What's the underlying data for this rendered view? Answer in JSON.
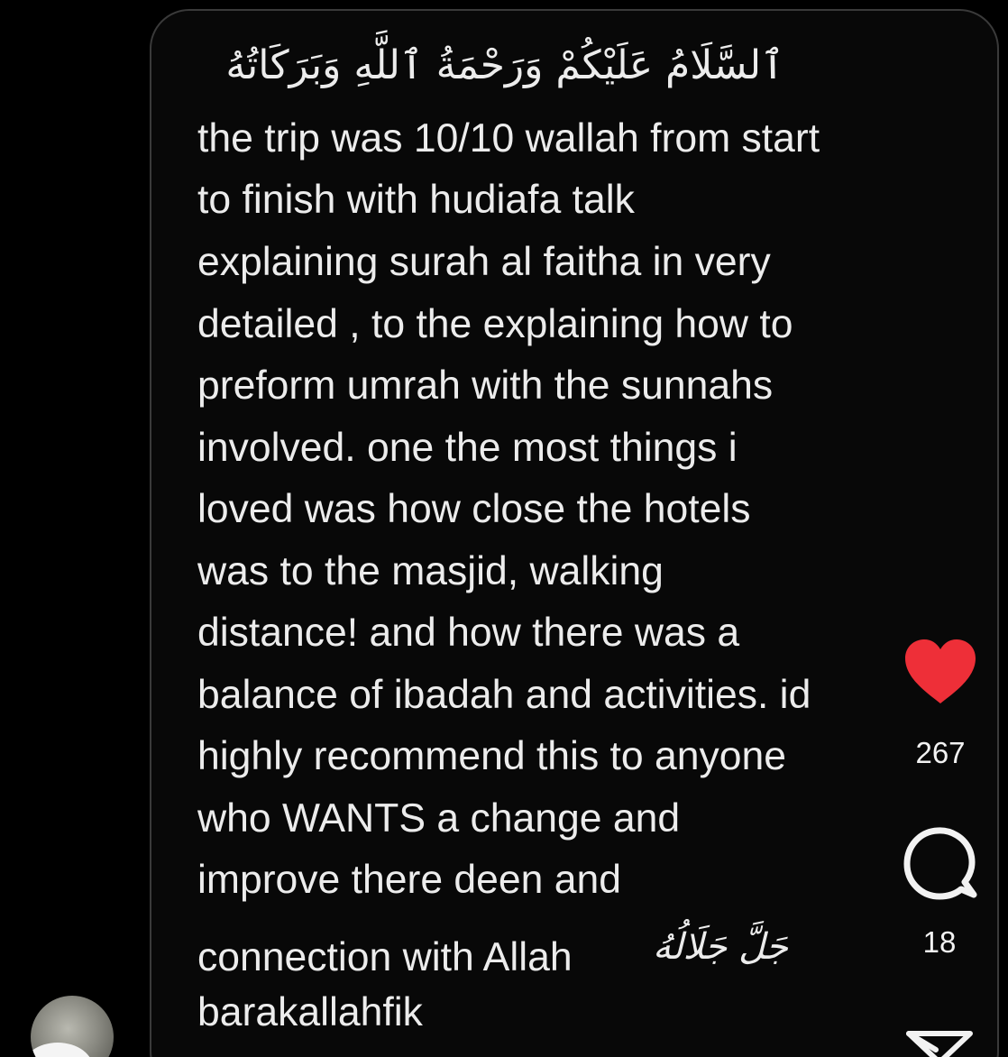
{
  "comment": {
    "greeting_arabic": "ٱلسَّلَامُ عَلَيْكُمْ وَرَحْمَةُ ٱللَّهِ وَبَرَكَاتُهُ",
    "lines": [
      "the trip was 10/10 wallah from start",
      "to finish with hudiafa talk",
      "explaining surah al faitha in very",
      "detailed , to the explaining how to",
      "preform umrah with the sunnahs",
      "involved. one the most things i",
      "loved was how close the hotels",
      "was to the masjid, walking",
      "distance! and how there was a",
      "balance of ibadah and activities. id",
      "highly recommend this to anyone",
      "who WANTS a change and",
      "improve there deen and",
      "connection with Allah",
      "barakallahfik"
    ],
    "allah_honorific": "جَلَّ جَلَالُهُ"
  },
  "actions": {
    "like_count": "267",
    "comment_count": "18",
    "like_color": "#ee2f38"
  },
  "icons": {
    "like": "heart-icon",
    "comment": "speech-bubble-icon",
    "share": "paper-plane-icon"
  }
}
